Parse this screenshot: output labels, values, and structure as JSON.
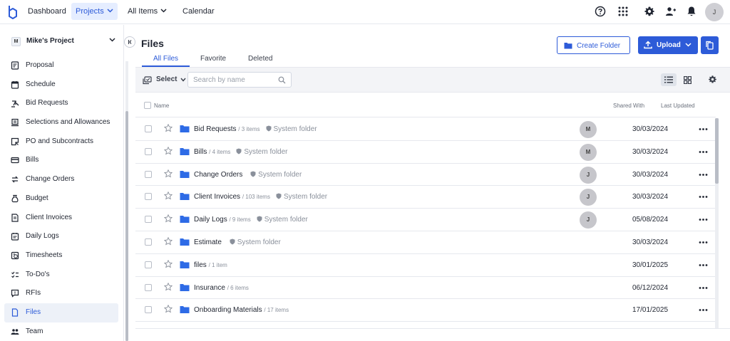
{
  "topnav": {
    "items": [
      {
        "label": "Dashboard"
      },
      {
        "label": "Projects"
      },
      {
        "label": "All Items"
      },
      {
        "label": "Calendar"
      }
    ],
    "avatar": "J"
  },
  "sidebar": {
    "project_badge": "M",
    "project_name": "Mike's Project",
    "items": [
      {
        "label": "Proposal",
        "icon": "proposal-icon"
      },
      {
        "label": "Schedule",
        "icon": "schedule-icon"
      },
      {
        "label": "Bid Requests",
        "icon": "bid-requests-icon"
      },
      {
        "label": "Selections and Allowances",
        "icon": "selections-icon"
      },
      {
        "label": "PO and Subcontracts",
        "icon": "po-icon"
      },
      {
        "label": "Bills",
        "icon": "bills-icon"
      },
      {
        "label": "Change Orders",
        "icon": "change-orders-icon"
      },
      {
        "label": "Budget",
        "icon": "budget-icon"
      },
      {
        "label": "Client Invoices",
        "icon": "client-invoices-icon"
      },
      {
        "label": "Daily Logs",
        "icon": "daily-logs-icon"
      },
      {
        "label": "Timesheets",
        "icon": "timesheets-icon"
      },
      {
        "label": "To-Do's",
        "icon": "todos-icon"
      },
      {
        "label": "RFIs",
        "icon": "rfis-icon"
      },
      {
        "label": "Files",
        "icon": "files-icon",
        "active": true
      },
      {
        "label": "Team",
        "icon": "team-icon"
      }
    ]
  },
  "main": {
    "title": "Files",
    "tabs": [
      {
        "label": "All Files",
        "active": true
      },
      {
        "label": "Favorite"
      },
      {
        "label": "Deleted"
      }
    ],
    "create_folder": "Create Folder",
    "upload": "Upload",
    "toolbar": {
      "select_label": "Select",
      "search_placeholder": "Search by name"
    },
    "columns": {
      "name": "Name",
      "shared": "Shared With",
      "updated": "Last Updated"
    },
    "rows": [
      {
        "name": "Bid Requests",
        "count": "/ 3 items",
        "system": "System folder",
        "shared": "M",
        "date": "30/03/2024"
      },
      {
        "name": "Bills",
        "count": "/ 4 items",
        "system": "System folder",
        "shared": "M",
        "date": "30/03/2024"
      },
      {
        "name": "Change Orders",
        "count": "",
        "system": "System folder",
        "shared": "J",
        "date": "30/03/2024"
      },
      {
        "name": "Client Invoices",
        "count": "/ 103 items",
        "system": "System folder",
        "shared": "J",
        "date": "30/03/2024"
      },
      {
        "name": "Daily Logs",
        "count": "/ 9 items",
        "system": "System folder",
        "shared": "J",
        "date": "05/08/2024"
      },
      {
        "name": "Estimate",
        "count": "",
        "system": "System folder",
        "shared": "",
        "date": "30/03/2024"
      },
      {
        "name": "files",
        "count": "/ 1 item",
        "system": "",
        "shared": "",
        "date": "30/01/2025"
      },
      {
        "name": "Insurance",
        "count": "/ 6 items",
        "system": "",
        "shared": "",
        "date": "06/12/2024"
      },
      {
        "name": "Onboarding Materials",
        "count": "/ 17 items",
        "system": "",
        "shared": "",
        "date": "17/01/2025"
      }
    ]
  },
  "colors": {
    "accent": "#2d5bd8",
    "folder": "#2e6be6"
  }
}
